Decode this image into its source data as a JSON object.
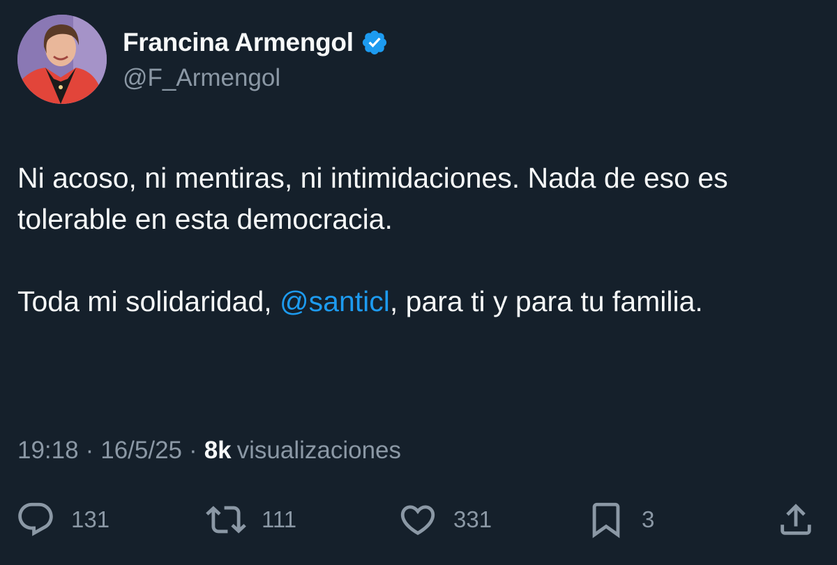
{
  "author": {
    "display_name": "Francina Armengol",
    "handle": "@F_Armengol",
    "verified_icon": "verified-badge-icon",
    "avatar_icon": "profile-photo"
  },
  "tweet": {
    "line1_text": "Ni acoso, ni mentiras, ni intimidaciones. Nada de eso es tolerable en esta democracia.",
    "line2_before": "Toda mi solidaridad, ",
    "line2_mention": "@santicl",
    "line2_after": ", para ti y para tu familia."
  },
  "meta": {
    "time": "19:18",
    "separator": "·",
    "date": "16/5/25",
    "views_count": "8k",
    "views_label": "visualizaciones"
  },
  "actions": {
    "reply": {
      "icon": "reply-icon",
      "count": "131"
    },
    "retweet": {
      "icon": "retweet-icon",
      "count": "111"
    },
    "like": {
      "icon": "heart-icon",
      "count": "331"
    },
    "bookmark": {
      "icon": "bookmark-icon",
      "count": "3"
    },
    "share": {
      "icon": "share-icon"
    }
  },
  "colors": {
    "background": "#15202b",
    "primary_text": "#f7f9f9",
    "secondary_text": "#8b98a5",
    "accent": "#1d9bf0"
  }
}
